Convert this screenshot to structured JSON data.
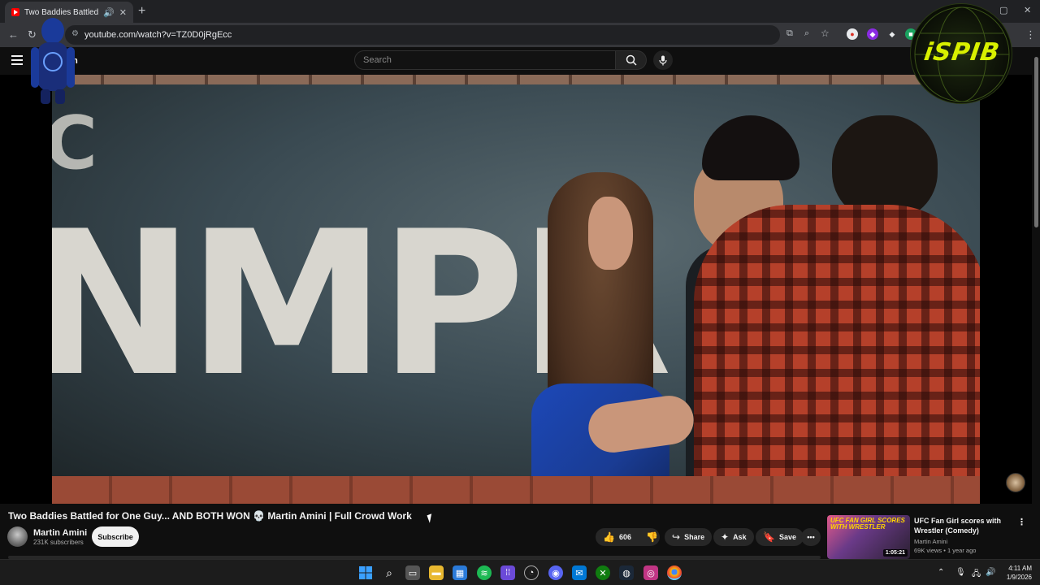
{
  "browser": {
    "tab_title": "Two Baddies Battled for One Guy",
    "new_tab_icon": "+",
    "url": "youtube.com/watch?v=TZ0D0jRgEcc"
  },
  "youtube": {
    "logo_text": "m",
    "search_placeholder": "Search"
  },
  "video": {
    "sign_text": "NMPR",
    "sign_partial_left": "C"
  },
  "overlays": {
    "right_logo_text": "iSPIB"
  },
  "details": {
    "title": "Two Baddies Battled for One Guy... AND BOTH WON 💀 Martin Amini | Full Crowd Work",
    "channel_name": "Martin Amini",
    "subscribers": "231K subscribers",
    "subscribe_label": "Subscribe",
    "like_count": "606",
    "share_label": "Share",
    "ask_label": "Ask",
    "save_label": "Save",
    "more_label": "•••"
  },
  "recommendation": {
    "thumb_text": "UFC FAN GIRL SCORES WITH WRESTLER",
    "duration": "1:05:21",
    "title": "UFC Fan Girl scores with Wrestler (Comedy)",
    "channel": "Martin Amini",
    "meta": "69K views • 1 year ago"
  },
  "taskbar": {
    "time": "4:11 AM",
    "date": "1/9/2026"
  },
  "colors": {
    "yt_bg": "#0f0f0f",
    "subscribe_bg": "#f1f1f1",
    "pill_bg": "#272727",
    "overlay_text": "#d8f000"
  }
}
